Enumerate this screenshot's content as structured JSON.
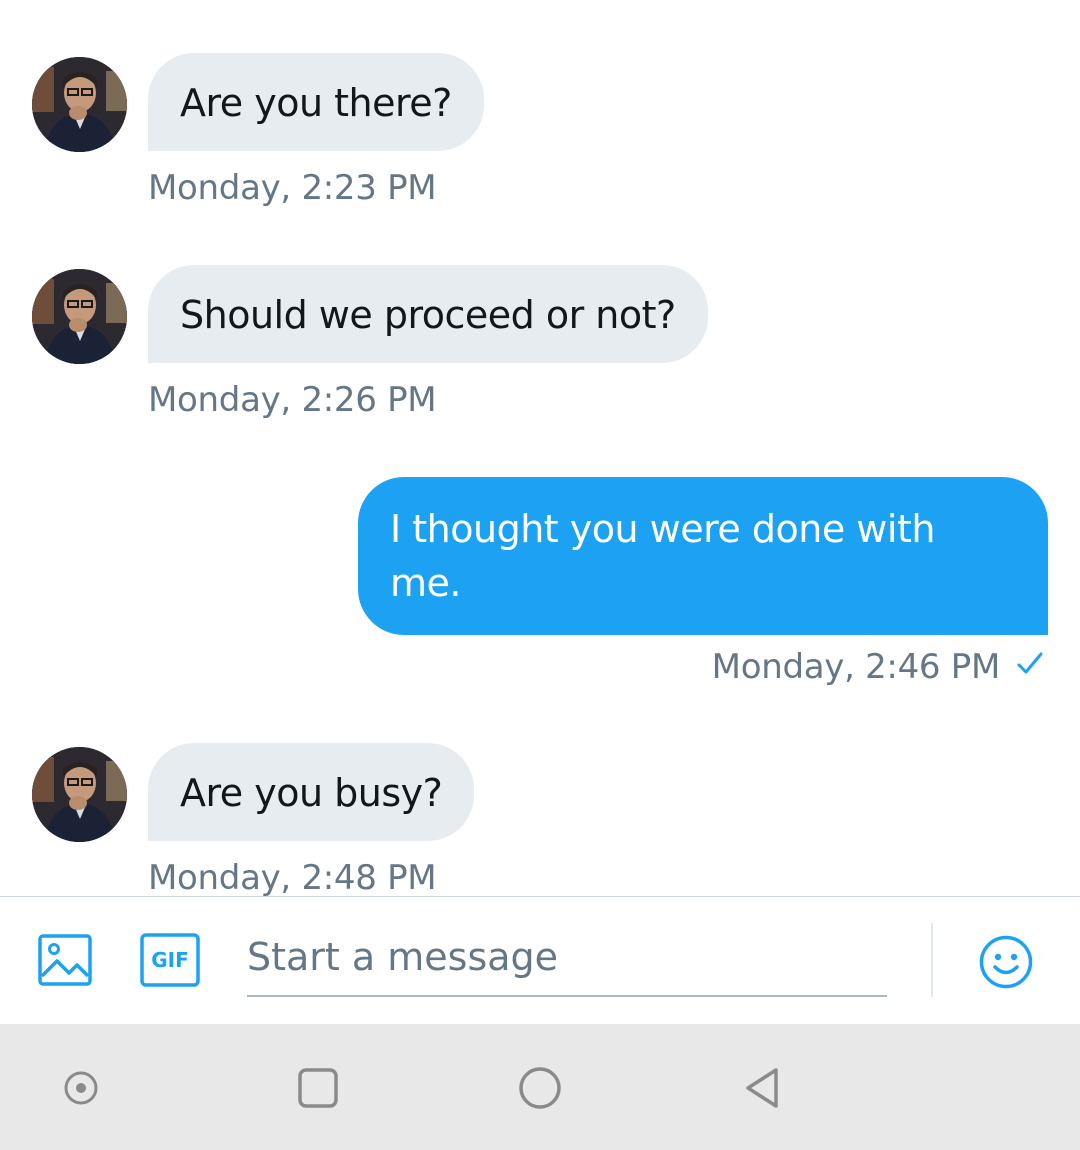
{
  "messages": [
    {
      "direction": "in",
      "text": "Are you there?",
      "timestamp": "Monday, 2:23 PM"
    },
    {
      "direction": "in",
      "text": "Should we proceed or not?",
      "timestamp": "Monday, 2:26 PM"
    },
    {
      "direction": "out",
      "text_line1": "I thought you were done with",
      "text_line2": "me.",
      "timestamp": "Monday, 2:46 PM",
      "status_icon": "checkmark-icon"
    },
    {
      "direction": "in",
      "text": "Are you busy?",
      "timestamp": "Monday, 2:48 PM"
    }
  ],
  "composer": {
    "placeholder": "Start a message",
    "gif_label": "GIF",
    "icons": [
      "image-icon",
      "gif-icon",
      "emoji-icon"
    ]
  },
  "navbar": {
    "icons": [
      "assistant-dot-icon",
      "recents-square-icon",
      "home-circle-icon",
      "back-triangle-icon"
    ]
  },
  "colors": {
    "accent": "#1da1f2",
    "incoming_bubble": "#e6ecf0",
    "timestamp": "#657786",
    "navbar_bg": "#e8e8e8"
  }
}
